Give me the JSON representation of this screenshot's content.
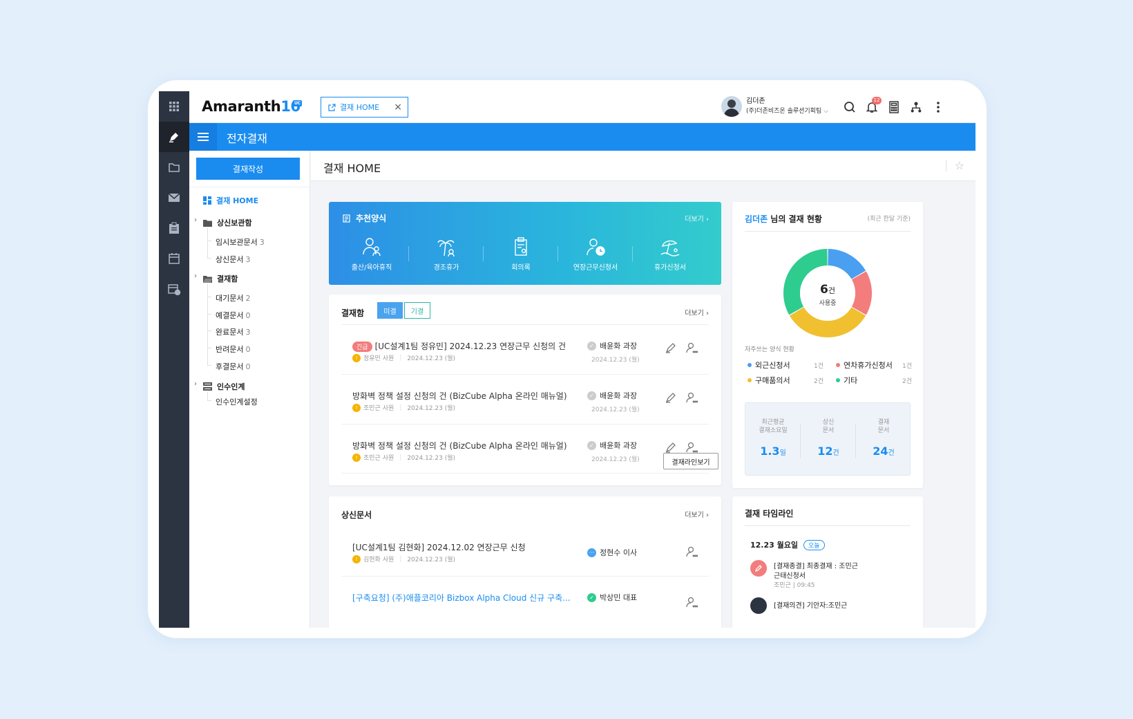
{
  "app": {
    "logo_text": "Amaranth",
    "logo_num": "10",
    "logo_badge": "UC",
    "open_tab": "결재 HOME",
    "module_title": "전자결재"
  },
  "user": {
    "name": "김더존",
    "company": "(주)더존비즈온 솔루션기획팀",
    "notification_count": "12"
  },
  "lnb": {
    "write_button": "결재작성",
    "home": "결재 HOME",
    "groups": [
      {
        "label": "상신보관함",
        "items": [
          {
            "label": "임시보관문서",
            "count": "3"
          },
          {
            "label": "상신문서",
            "count": "3"
          }
        ]
      },
      {
        "label": "결재함",
        "items": [
          {
            "label": "대기문서",
            "count": "2"
          },
          {
            "label": "예결문서",
            "count": "0"
          },
          {
            "label": "완료문서",
            "count": "3"
          },
          {
            "label": "반려문서",
            "count": "0"
          },
          {
            "label": "후결문서",
            "count": "0"
          }
        ]
      },
      {
        "label": "인수인계",
        "items": [
          {
            "label": "인수인계설정",
            "count": ""
          }
        ]
      }
    ]
  },
  "page": {
    "title": "결재 HOME"
  },
  "recommend": {
    "title": "추천양식",
    "more": "더보기",
    "forms": [
      {
        "label": "출산/육아휴직",
        "icon": "parent-child-icon"
      },
      {
        "label": "경조휴가",
        "icon": "palm-tree-icon"
      },
      {
        "label": "회의록",
        "icon": "clipboard-user-icon"
      },
      {
        "label": "연장근무신청서",
        "icon": "user-clock-icon"
      },
      {
        "label": "휴가신청서",
        "icon": "beach-icon"
      }
    ]
  },
  "inbox": {
    "title": "결재함",
    "tabs": [
      "미결",
      "기결"
    ],
    "more": "더보기",
    "tooltip": "결재라인보기",
    "rows": [
      {
        "urgent": "긴급",
        "subject": "[UC설계1팀 정유민] 2024.12.23 연장근무 신청의 건",
        "drafter": "정유민 사원",
        "date": "2024.12.23 (월)",
        "approver": "배윤화 과장",
        "approver_date": "2024.12.23 (월)"
      },
      {
        "urgent": "",
        "subject": "방화벽 정책 설정 신청의 건 (BizCube Alpha 온라인 매뉴얼)",
        "drafter": "조민근 사원",
        "date": "2024.12.23 (월)",
        "approver": "배윤화 과장",
        "approver_date": "2024.12.23 (월)"
      },
      {
        "urgent": "",
        "subject": "방화벽 정책 설정 신청의 건 (BizCube Alpha 온라인 매뉴얼)",
        "drafter": "조민근 사원",
        "date": "2024.12.23 (월)",
        "approver": "배윤화 과장",
        "approver_date": "2024.12.23 (월)"
      }
    ]
  },
  "sent": {
    "title": "상신문서",
    "more": "더보기",
    "rows": [
      {
        "subject": "[UC설계1팀 김현화] 2024.12.02 연장근무 신청",
        "drafter": "김현화 사원",
        "date": "2024.12.23 (월)",
        "approver": "정현수 이사",
        "status": "pending"
      },
      {
        "subject": "[구축요청] (주)애플코리아 Bizbox Alpha Cloud 신규 구축...",
        "drafter": "",
        "date": "",
        "approver": "박상민 대표",
        "status": "done"
      }
    ]
  },
  "status": {
    "name": "김더존",
    "title_suffix": " 님의 결재 현황",
    "sub": "(최근 한달 기준)",
    "donut_value": "6",
    "donut_unit": "건",
    "donut_label": "사용중",
    "freq_title": "자주쓰는 양식 현황",
    "chart_data": {
      "type": "pie",
      "categories": [
        "외근신청서",
        "연차휴가신청서",
        "구매품의서",
        "기타"
      ],
      "values": [
        1,
        1,
        2,
        2
      ],
      "colors": [
        "#4a9ff0",
        "#f37c7c",
        "#f0c030",
        "#2ecc8e"
      ],
      "display_order": [
        0,
        1,
        2,
        3
      ]
    },
    "legend": [
      {
        "label": "외근신청서",
        "value": "1건",
        "color": "#4a9ff0"
      },
      {
        "label": "연차휴가신청서",
        "value": "1건",
        "color": "#f37c7c"
      },
      {
        "label": "구매품의서",
        "value": "2건",
        "color": "#f0c030"
      },
      {
        "label": "기타",
        "value": "2건",
        "color": "#2ecc8e"
      }
    ],
    "summary": [
      {
        "label": "최근평균\n결재소요일",
        "value": "1.3",
        "unit": "일"
      },
      {
        "label": "상신\n문서",
        "value": "12",
        "unit": "건"
      },
      {
        "label": "결재\n문서",
        "value": "24",
        "unit": "건"
      }
    ]
  },
  "timeline": {
    "title": "결재 타임라인",
    "date": "12.23 월요일",
    "today": "오늘",
    "items": [
      {
        "title": "[결재종결] 최종결재 : 조민근",
        "title2": "근태신청서",
        "meta": "조민근  |  09:45"
      },
      {
        "title": "[결재의견] 기안자:조민근",
        "title2": "",
        "meta": ""
      }
    ]
  },
  "colors": {
    "accent": "#1a8cf0",
    "rail": "#2c3442",
    "urgent": "#f37c7c"
  }
}
